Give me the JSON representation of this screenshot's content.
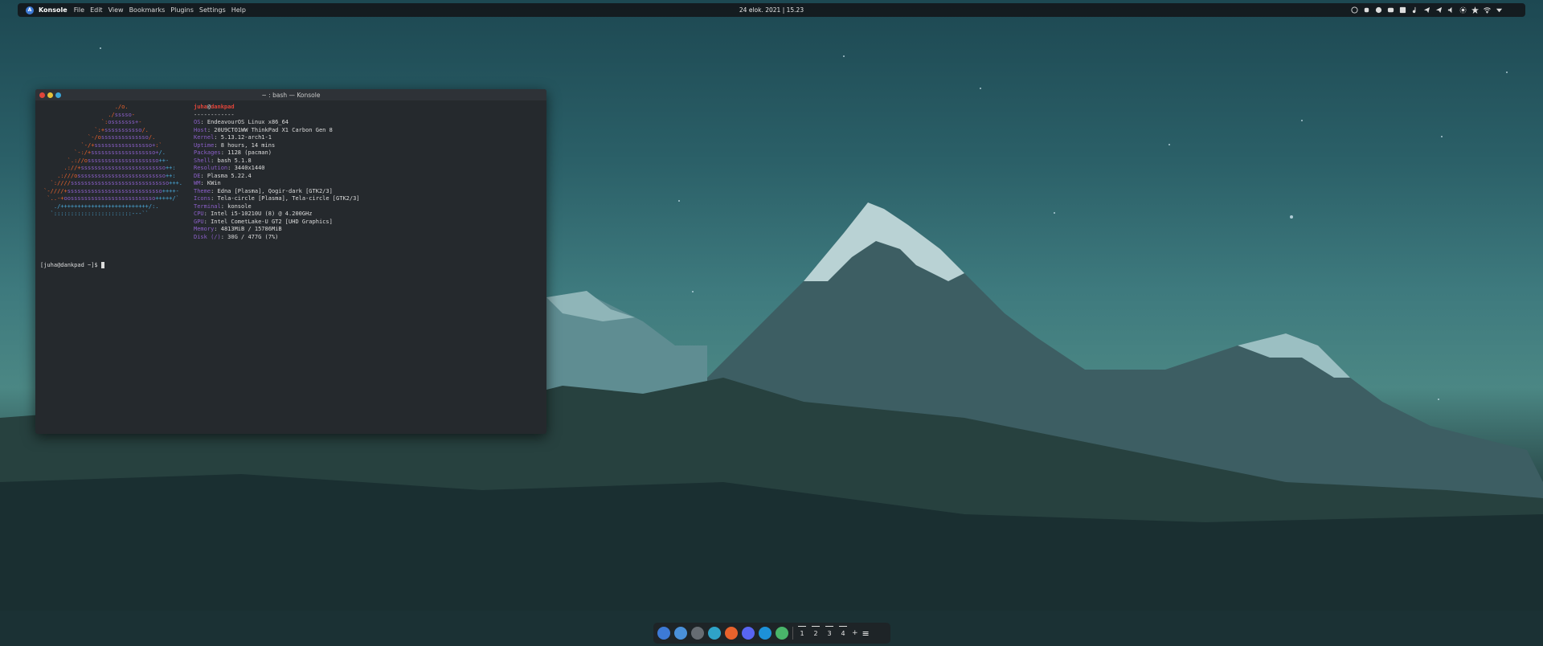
{
  "topbar": {
    "app_name": "Konsole",
    "menu": [
      "File",
      "Edit",
      "View",
      "Bookmarks",
      "Plugins",
      "Settings",
      "Help"
    ],
    "clock": "24 elok. 2021 | 15.23",
    "tray_icons": [
      "steam-icon",
      "app-icon",
      "discord-icon",
      "discord2-icon",
      "battery-icon",
      "music-icon",
      "telegram-icon",
      "telegram2-icon",
      "volume-icon",
      "brightness-icon",
      "star-icon",
      "wifi-icon",
      "dropdown-icon"
    ]
  },
  "window": {
    "title": "~ : bash — Konsole",
    "buttons": {
      "close": "#e0453a",
      "minimize": "#e6c23a",
      "maximize": "#3aa5d8"
    }
  },
  "neofetch": {
    "user": "juha",
    "at": "@",
    "host": "dankpad",
    "separator": "------------",
    "lines": [
      {
        "key": "OS",
        "value": "EndeavourOS Linux x86_64"
      },
      {
        "key": "Host",
        "value": "20U9CTO1WW ThinkPad X1 Carbon Gen 8"
      },
      {
        "key": "Kernel",
        "value": "5.13.12-arch1-1"
      },
      {
        "key": "Uptime",
        "value": "8 hours, 14 mins"
      },
      {
        "key": "Packages",
        "value": "1128 (pacman)"
      },
      {
        "key": "Shell",
        "value": "bash 5.1.8"
      },
      {
        "key": "Resolution",
        "value": "3440x1440"
      },
      {
        "key": "DE",
        "value": "Plasma 5.22.4"
      },
      {
        "key": "WM",
        "value": "KWin"
      },
      {
        "key": "Theme",
        "value": "Edna [Plasma], Qogir-dark [GTK2/3]"
      },
      {
        "key": "Icons",
        "value": "Tela-circle [Plasma], Tela-circle [GTK2/3]"
      },
      {
        "key": "Terminal",
        "value": "konsole"
      },
      {
        "key": "CPU",
        "value": "Intel i5-10210U (8) @ 4.200GHz"
      },
      {
        "key": "GPU",
        "value": "Intel CometLake-U GT2 [UHD Graphics]"
      },
      {
        "key": "Memory",
        "value": "4813MiB / 15786MiB"
      },
      {
        "key": "Disk (/)",
        "value": "30G / 477G (7%)"
      }
    ],
    "prompt": "[juha@dankpad ~]$ "
  },
  "dock": {
    "icons": [
      {
        "name": "app-launcher-icon",
        "color": "#3d7ad6"
      },
      {
        "name": "files-icon",
        "color": "#4a90d9"
      },
      {
        "name": "settings-icon",
        "color": "#666c72"
      },
      {
        "name": "store-icon",
        "color": "#2fa3c8"
      },
      {
        "name": "firefox-icon",
        "color": "#e8622c"
      },
      {
        "name": "discord-icon",
        "color": "#5865f2"
      },
      {
        "name": "docker-icon",
        "color": "#1d91d8"
      },
      {
        "name": "update-icon",
        "color": "#49b56a"
      }
    ],
    "workspaces": [
      "1",
      "2",
      "3",
      "4"
    ],
    "add_label": "+",
    "menu_label": "≡"
  }
}
